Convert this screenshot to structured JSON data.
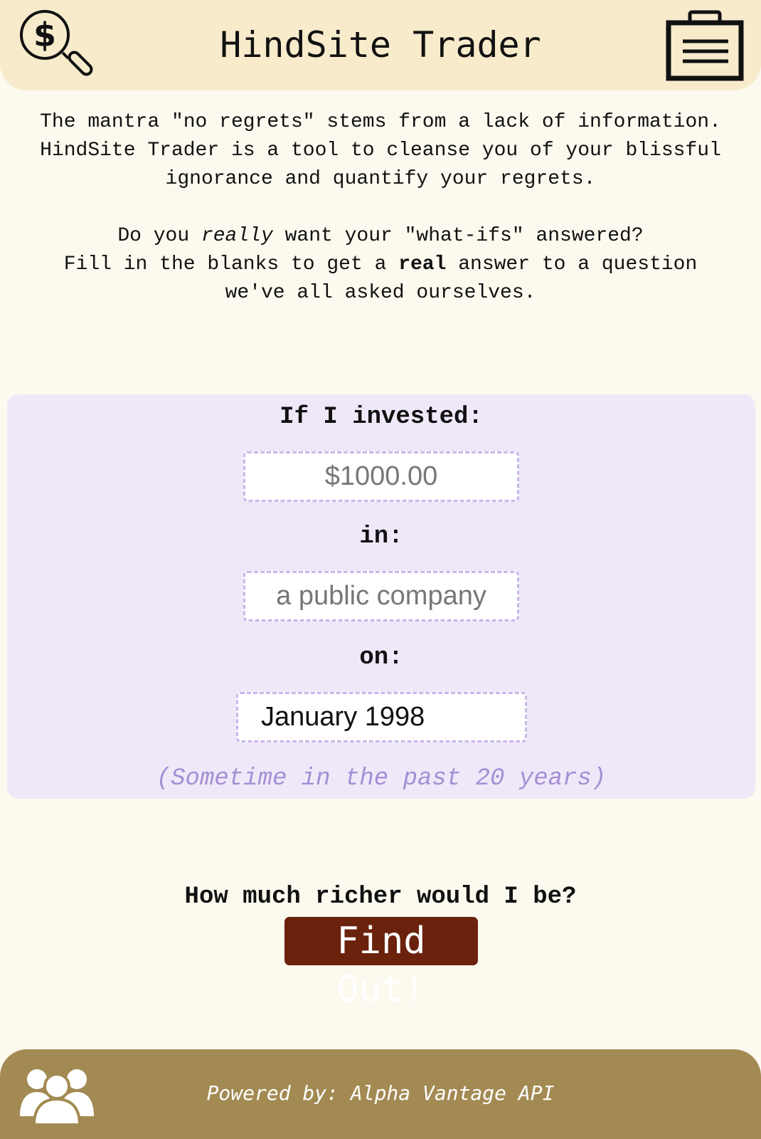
{
  "header": {
    "title": "HindSite Trader",
    "logo_icon": "dollar-magnifier-icon",
    "menu_icon": "briefcase-icon"
  },
  "intro": {
    "paragraph1_lines": [
      "The mantra \"no regrets\" stems from a lack of information.",
      "HindSite Trader is a tool to cleanse you of your blissful",
      "ignorance and quantify your regrets."
    ],
    "paragraph2": {
      "line1_before": "Do you ",
      "line1_emphasis": "really",
      "line1_after": " want your \"what-ifs\" answered?",
      "line2_before": "Fill in the blanks to get a ",
      "line2_strong": "real",
      "line2_after": " answer to a question",
      "line3": "we've all asked ourselves."
    }
  },
  "form": {
    "amount_label": "If I invested:",
    "amount_placeholder": "$1000.00",
    "company_label": "in:",
    "company_placeholder": "a public company",
    "date_label": "on:",
    "date_value": "January 1998",
    "hint": "(Sometime in the past 20 years)",
    "card_color": "#efe8f9",
    "field_border_color": "#c9b8ea",
    "hint_color": "#a48fd4"
  },
  "cta": {
    "question": "How much richer would I be?",
    "button_label": "Find Out!",
    "button_color": "#6b220d"
  },
  "footer": {
    "powered_by": "Powered by: Alpha Vantage API",
    "team_icon": "team-icon",
    "background_color": "#a38a53"
  },
  "colors": {
    "page_background": "#fcf9ee",
    "header_background": "#f7ebcc"
  }
}
